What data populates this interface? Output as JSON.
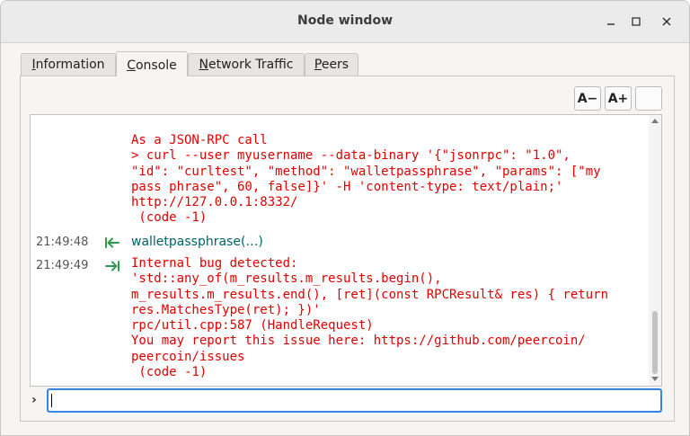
{
  "window": {
    "title": "Node window"
  },
  "tabs": [
    {
      "label": "Information",
      "mnemonic": "I",
      "rest": "nformation"
    },
    {
      "label": "Console",
      "mnemonic": "C",
      "rest": "onsole"
    },
    {
      "label": "Network Traffic",
      "mnemonic": "N",
      "rest": "etwork Traffic"
    },
    {
      "label": "Peers",
      "mnemonic": "P",
      "rest": "eers"
    }
  ],
  "toolbar": {
    "font_smaller": "A−",
    "font_bigger": "A+",
    "clear": ""
  },
  "console": {
    "top_fragment": "·",
    "block1": "As a JSON-RPC call\n> curl --user myusername --data-binary '{\"jsonrpc\": \"1.0\",\n\"id\": \"curltest\", \"method\": \"walletpassphrase\", \"params\": [\"my\npass phrase\", 60, false]}' -H 'content-type: text/plain;'\nhttp://127.0.0.1:8332/\n (code -1)",
    "entry1": {
      "time": "21:49:48",
      "command": "walletpassphrase(…)"
    },
    "entry2": {
      "time": "21:49:49",
      "text": "Internal bug detected:\n'std::any_of(m_results.m_results.begin(),\nm_results.m_results.end(), [ret](const RPCResult& res) { return\nres.MatchesType(ret); })'\nrpc/util.cpp:587 (HandleRequest)\nYou may report this issue here: https://github.com/peercoin/\npeercoin/issues\n (code -1)"
    }
  },
  "input": {
    "prompt": "›",
    "value": ""
  },
  "colors": {
    "error": "#e00000",
    "command": "#006468",
    "focus": "#3584e4"
  },
  "icons": {
    "request": "arrow-left-icon",
    "reply": "arrow-right-icon"
  }
}
